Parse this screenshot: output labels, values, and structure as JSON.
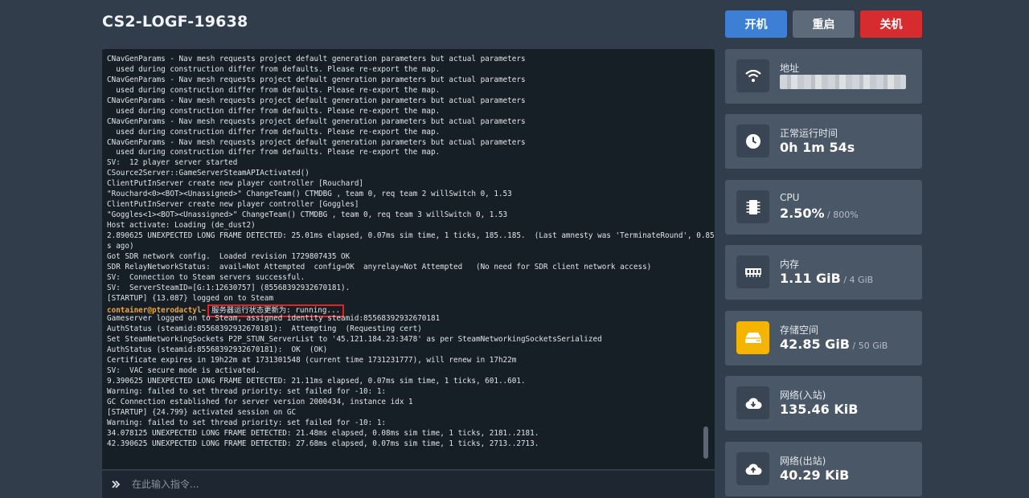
{
  "header": {
    "server_name": "CS2-LOGF-19638",
    "start_label": "开机",
    "restart_label": "重启",
    "stop_label": "关机"
  },
  "console": {
    "lines": [
      "CNavGenParams - Nav mesh requests project default generation parameters but actual parameters",
      "  used during construction differ from defaults. Please re-export the map.",
      "CNavGenParams - Nav mesh requests project default generation parameters but actual parameters",
      "  used during construction differ from defaults. Please re-export the map.",
      "CNavGenParams - Nav mesh requests project default generation parameters but actual parameters",
      "  used during construction differ from defaults. Please re-export the map.",
      "CNavGenParams - Nav mesh requests project default generation parameters but actual parameters",
      "  used during construction differ from defaults. Please re-export the map.",
      "CNavGenParams - Nav mesh requests project default generation parameters but actual parameters",
      "  used during construction differ from defaults. Please re-export the map.",
      "SV:  12 player server started",
      "CSource2Server::GameServerSteamAPIActivated()",
      "ClientPutInServer create new player controller [Rouchard]",
      "\"Rouchard<0><BOT><Unassigned>\" ChangeTeam() CTMDBG , team 0, req team 2 willSwitch 0, 1.53",
      "ClientPutInServer create new player controller [Goggles]",
      "\"Goggles<1><BOT><Unassigned>\" ChangeTeam() CTMDBG , team 0, req team 3 willSwitch 0, 1.53",
      "Host activate: Loading (de_dust2)",
      "2.890625 UNEXPECTED LONG FRAME DETECTED: 25.01ms elapsed, 0.07ms sim time, 1 ticks, 185..185.  (Last amnesty was 'TerminateRound', 0.85",
      "s ago)",
      "Got SDR network config.  Loaded revision 1729807435 OK",
      "SDR RelayNetworkStatus:  avail=Not Attempted  config=OK  anyrelay=Not Attempted   (No need for SDR client network access)",
      "SV:  Connection to Steam servers successful.",
      "SV:  ServerSteamID=[G:1:12630757] (85568392932670181).",
      "[STARTUP] {13.087} logged on to Steam"
    ],
    "prompt": "container@pterodactyl~",
    "status_message": "服务器运行状态更新为: running...",
    "lines_after": [
      "Gameserver logged on to Steam, assigned identity steamid:85568392932670181",
      "AuthStatus (steamid:85568392932670181):  Attempting  (Requesting cert)",
      "Set SteamNetworkingSockets P2P_STUN_ServerList to '45.121.184.23:3478' as per SteamNetworkingSocketsSerialized",
      "AuthStatus (steamid:85568392932670181):  OK  (OK)",
      "Certificate expires in 19h22m at 1731301548 (current time 1731231777), will renew in 17h22m",
      "SV:  VAC secure mode is activated.",
      "9.390625 UNEXPECTED LONG FRAME DETECTED: 21.11ms elapsed, 0.07ms sim time, 1 ticks, 601..601.",
      "Warning: failed to set thread priority: set failed for -10: 1:",
      "GC Connection established for server version 2000434, instance idx 1",
      "[STARTUP] {24.799} activated session on GC",
      "Warning: failed to set thread priority: set failed for -10: 1:",
      "34.078125 UNEXPECTED LONG FRAME DETECTED: 21.48ms elapsed, 0.08ms sim time, 1 ticks, 2181..2181.",
      "42.390625 UNEXPECTED LONG FRAME DETECTED: 27.68ms elapsed, 0.07ms sim time, 1 ticks, 2713..2713."
    ],
    "input_placeholder": "在此输入指令..."
  },
  "stats": {
    "address": {
      "label": "地址",
      "icon": "wifi-icon"
    },
    "uptime": {
      "label": "正常运行时间",
      "value": "0h 1m 54s",
      "icon": "clock-icon"
    },
    "cpu": {
      "label": "CPU",
      "value": "2.50%",
      "limit": " / 800%",
      "icon": "cpu-chip-icon"
    },
    "memory": {
      "label": "内存",
      "value": "1.11 GiB",
      "limit": " / 4 GiB",
      "icon": "memory-icon"
    },
    "disk": {
      "label": "存储空间",
      "value": "42.85 GiB",
      "limit": " / 50 GiB",
      "icon": "hdd-icon",
      "icon_bg": "#f4b400"
    },
    "net_in": {
      "label": "网络(入站)",
      "value": "135.46 KiB",
      "icon": "cloud-download-icon"
    },
    "net_out": {
      "label": "网络(出站)",
      "value": "40.29 KiB",
      "icon": "cloud-upload-icon"
    }
  }
}
